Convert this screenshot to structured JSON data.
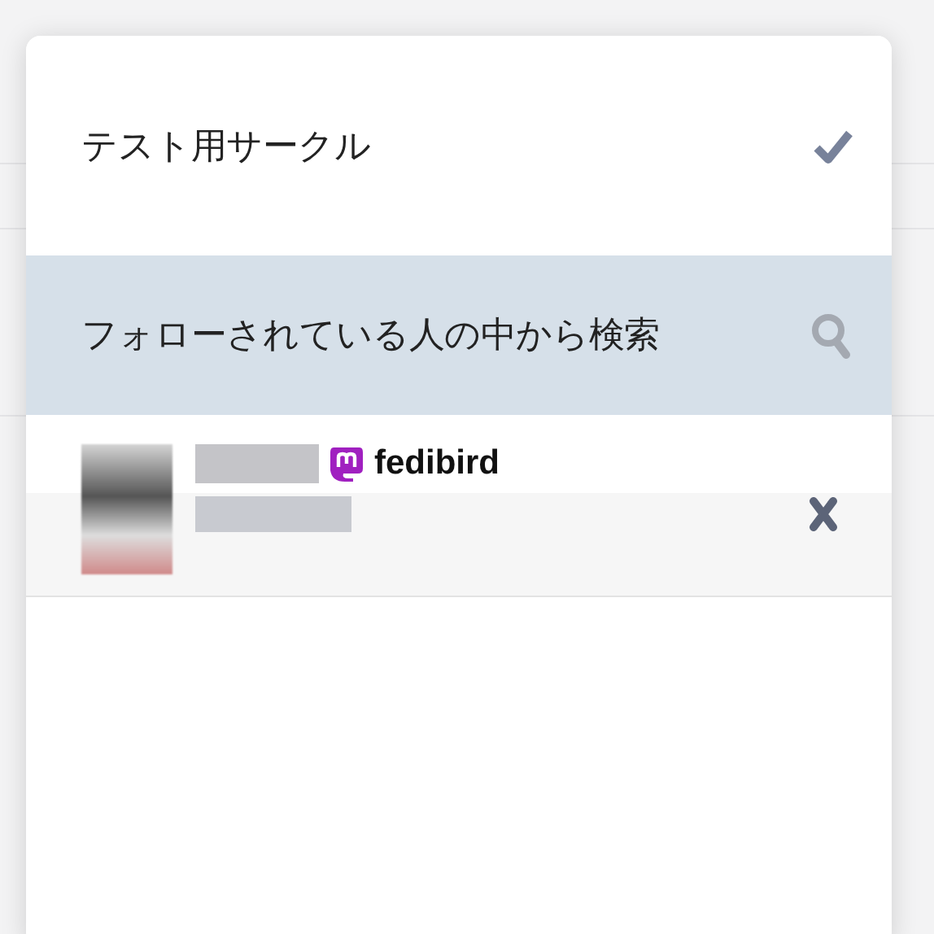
{
  "circle": {
    "name": "テスト用サークル",
    "checked": true
  },
  "search": {
    "label": "フォローされている人の中から検索"
  },
  "members": [
    {
      "domain": "fedibird"
    }
  ]
}
